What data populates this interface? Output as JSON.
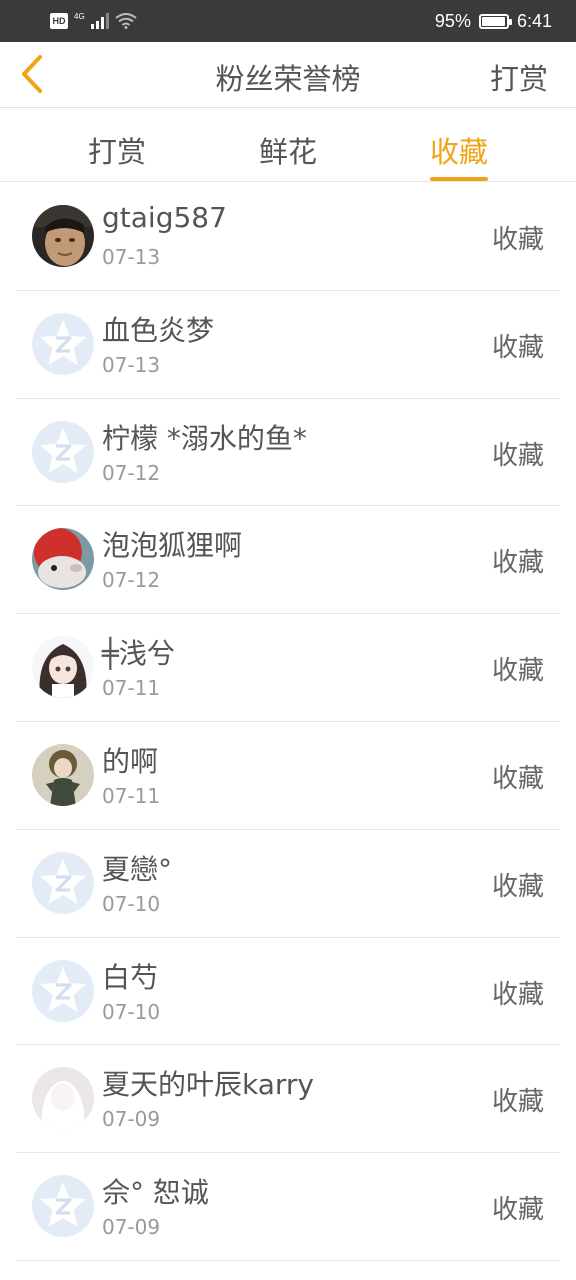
{
  "status_bar": {
    "left_badge": "HD",
    "network": "4G",
    "battery": "95%",
    "battery_level": 0.95,
    "time": "6:41"
  },
  "header": {
    "title": "粉丝荣誉榜",
    "right_action": "打赏"
  },
  "tabs": [
    {
      "label": "打赏",
      "active": false
    },
    {
      "label": "鲜花",
      "active": false
    },
    {
      "label": "收藏",
      "active": true
    }
  ],
  "accent_color": "#f0a418",
  "fans": [
    {
      "name": "gtaig587",
      "date": "07-13",
      "action": "收藏",
      "avatar": "photo-man"
    },
    {
      "name": "血色炎梦",
      "date": "07-13",
      "action": "收藏",
      "avatar": "default-star"
    },
    {
      "name": "柠檬 *溺水的鱼*",
      "date": "07-12",
      "action": "收藏",
      "avatar": "default-star"
    },
    {
      "name": "泡泡狐狸啊",
      "date": "07-12",
      "action": "收藏",
      "avatar": "photo-fox"
    },
    {
      "name": "╪浅兮",
      "date": "07-11",
      "action": "收藏",
      "avatar": "anime-girl"
    },
    {
      "name": "的啊",
      "date": "07-11",
      "action": "收藏",
      "avatar": "anime-figure"
    },
    {
      "name": "夏戀°",
      "date": "07-10",
      "action": "收藏",
      "avatar": "default-star"
    },
    {
      "name": "白芍",
      "date": "07-10",
      "action": "收藏",
      "avatar": "default-star"
    },
    {
      "name": "夏天的叶辰karry",
      "date": "07-09",
      "action": "收藏",
      "avatar": "default-silhouette"
    },
    {
      "name": "佘° 恕诚",
      "date": "07-09",
      "action": "收藏",
      "avatar": "default-star"
    }
  ]
}
